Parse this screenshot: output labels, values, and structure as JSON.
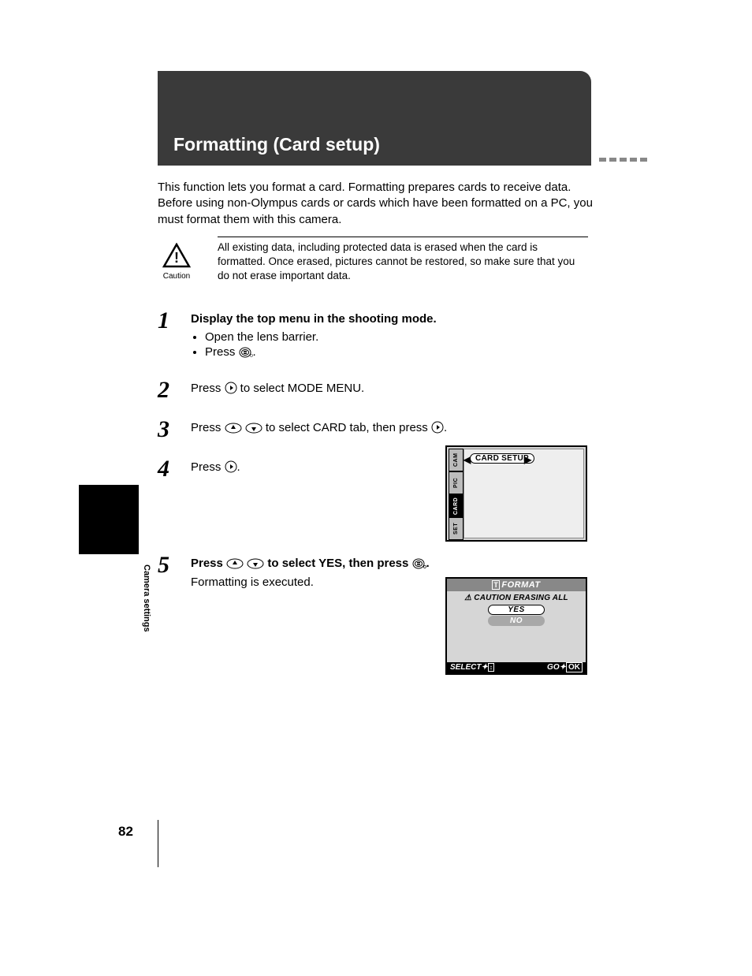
{
  "header": {
    "title": "Formatting (Card setup)"
  },
  "intro": "This function lets you format a card. Formatting prepares cards to receive data. Before using non-Olympus cards or cards which have been formatted on a PC, you must format them with this camera.",
  "caution": {
    "label": "Caution",
    "text": "All existing data, including protected data is erased when the card is formatted. Once erased, pictures cannot be restored, so make sure that you do not erase important data."
  },
  "steps": {
    "s1": {
      "num": "1",
      "heading": "Display the top menu in the shooting mode.",
      "sub1": "Open the lens barrier.",
      "sub2_pre": "Press ",
      "sub2_post": "."
    },
    "s2": {
      "num": "2",
      "pre": "Press ",
      "post": " to select MODE MENU."
    },
    "s3": {
      "num": "3",
      "pre": "Press ",
      "mid": " to select CARD tab, then press ",
      "post": "."
    },
    "s4": {
      "num": "4",
      "pre": "Press ",
      "post": "."
    },
    "s5": {
      "num": "5",
      "pre": "Press ",
      "mid": " to select YES, then press ",
      "post": ".",
      "note": "Formatting is executed."
    }
  },
  "lcd1": {
    "tabs": [
      "CAM",
      "PIC",
      "CARD",
      "SET"
    ],
    "active_tab": "CARD",
    "item": "CARD SETUP"
  },
  "lcd2": {
    "title": "FORMAT",
    "warn": "CAUTION  ERASING ALL",
    "yes": "YES",
    "no": "NO",
    "select": "SELECT",
    "go": "GO",
    "ok": "OK"
  },
  "side_label": "Camera settings",
  "page_number": "82"
}
